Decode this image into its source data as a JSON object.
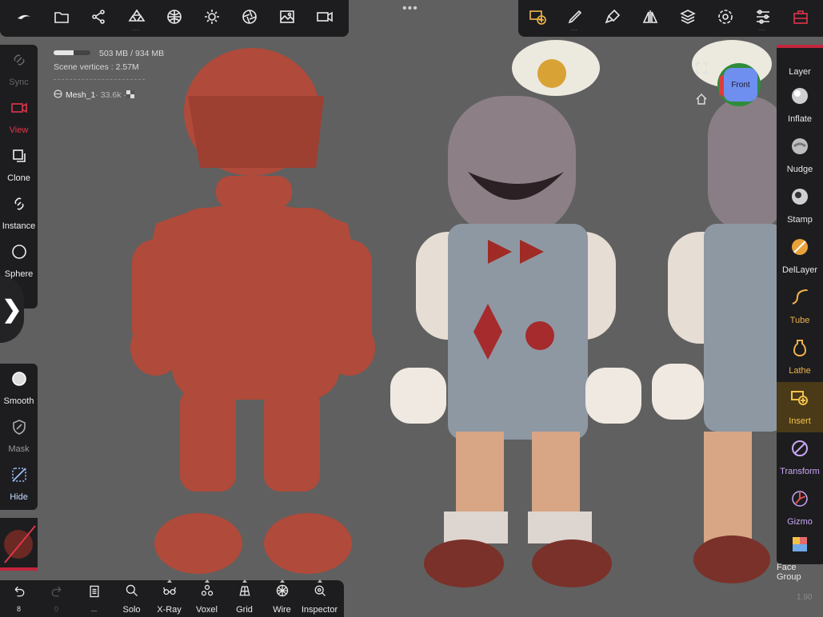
{
  "top_left_tools": [
    {
      "name": "sculptris-logo-icon"
    },
    {
      "name": "folder-icon"
    },
    {
      "name": "scene-graph-icon"
    },
    {
      "name": "mesh-library-icon",
      "dots": "..."
    },
    {
      "name": "matcap-sphere-icon"
    },
    {
      "name": "light-sun-icon"
    },
    {
      "name": "shading-aperture-icon"
    },
    {
      "name": "background-image-icon"
    },
    {
      "name": "camera-icon"
    }
  ],
  "top_right_tools": [
    {
      "name": "insert-tool-icon"
    },
    {
      "name": "brush-pen-icon",
      "dots": "..."
    },
    {
      "name": "paint-brush-icon"
    },
    {
      "name": "symmetry-icon"
    },
    {
      "name": "layers-icon"
    },
    {
      "name": "settings-gear-icon"
    },
    {
      "name": "sliders-icon",
      "dots": "..."
    },
    {
      "name": "tool-box-icon"
    }
  ],
  "more_dots": "•••",
  "left_tools": [
    {
      "id": "sync",
      "label": "Sync",
      "style": "dim"
    },
    {
      "id": "view",
      "label": "View",
      "style": "red"
    },
    {
      "id": "clone",
      "label": "Clone",
      "style": ""
    },
    {
      "id": "instance",
      "label": "Instance",
      "style": ""
    },
    {
      "id": "sphere",
      "label": "Sphere",
      "style": ""
    }
  ],
  "left_tools2": [
    {
      "id": "smooth",
      "label": "Smooth",
      "style": ""
    },
    {
      "id": "mask",
      "label": "Mask",
      "style": "muted"
    },
    {
      "id": "hide",
      "label": "Hide",
      "style": "blue"
    }
  ],
  "right_tools": [
    {
      "id": "layer",
      "label": "Layer",
      "style": ""
    },
    {
      "id": "inflate",
      "label": "Inflate",
      "style": ""
    },
    {
      "id": "nudge",
      "label": "Nudge",
      "style": ""
    },
    {
      "id": "stamp",
      "label": "Stamp",
      "style": ""
    },
    {
      "id": "dellayer",
      "label": "DelLayer",
      "style": ""
    },
    {
      "id": "tube",
      "label": "Tube",
      "style": "orange"
    },
    {
      "id": "lathe",
      "label": "Lathe",
      "style": "orange"
    },
    {
      "id": "insert",
      "label": "Insert",
      "style": "active"
    },
    {
      "id": "transform",
      "label": "Transform",
      "style": "violet"
    },
    {
      "id": "gizmo",
      "label": "Gizmo",
      "style": "violet"
    },
    {
      "id": "face-group",
      "label": "Face Group",
      "style": ""
    }
  ],
  "bottom_tools": [
    {
      "id": "undo",
      "label": "",
      "sub": "8",
      "style": ""
    },
    {
      "id": "redo",
      "label": "",
      "sub": "0",
      "style": "dim"
    },
    {
      "id": "pages",
      "label": "",
      "sub": "...",
      "style": ""
    },
    {
      "id": "solo",
      "label": "Solo",
      "sub": "",
      "style": ""
    },
    {
      "id": "xray",
      "label": "X-Ray",
      "sub": "",
      "style": "caret"
    },
    {
      "id": "voxel",
      "label": "Voxel",
      "sub": "",
      "style": "caret"
    },
    {
      "id": "grid",
      "label": "Grid",
      "sub": "",
      "style": "caret"
    },
    {
      "id": "wire",
      "label": "Wire",
      "sub": "",
      "style": "caret"
    },
    {
      "id": "inspector",
      "label": "Inspector",
      "sub": "",
      "style": "caret"
    }
  ],
  "info": {
    "memory": "503 MB / 934 MB",
    "memory_fraction": 0.54,
    "vertices": "Scene vertices : 2.57M",
    "mesh": "Mesh_1",
    "mesh_count": " · 33.6k · "
  },
  "view_cube": {
    "face": "Front"
  },
  "zoom": "1.90",
  "colors": {
    "accent_red": "#e0354c",
    "insert_active": "#f5c24d",
    "toolbar_bg": "#1d1d1f",
    "viewport_bg": "#606060"
  }
}
